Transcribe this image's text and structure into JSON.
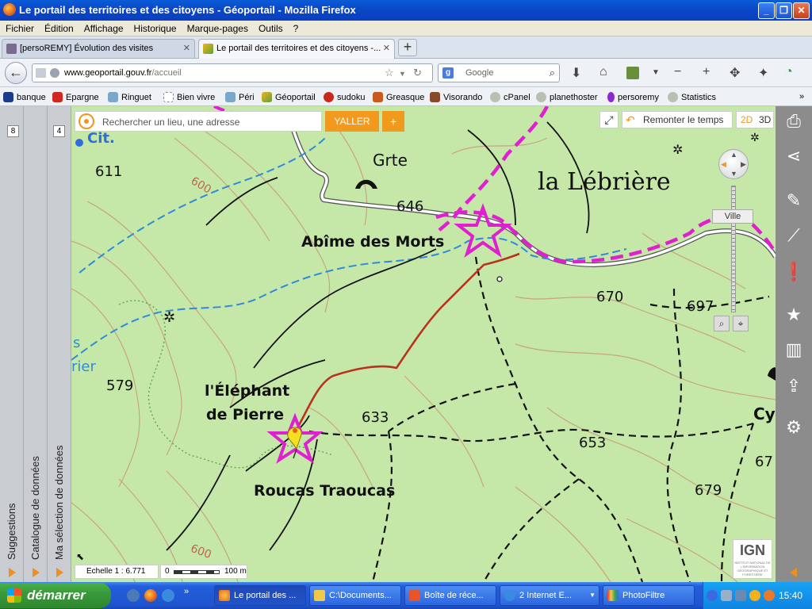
{
  "window": {
    "title": "Le portail des territoires et des citoyens - Géoportail - Mozilla Firefox"
  },
  "menu": [
    "Fichier",
    "Édition",
    "Affichage",
    "Historique",
    "Marque-pages",
    "Outils",
    "?"
  ],
  "tabs": [
    {
      "label": "[persoREMY] Évolution des visites",
      "active": false
    },
    {
      "label": "Le portail des territoires et des citoyens -...",
      "active": true
    }
  ],
  "nav": {
    "url_host": "www.geoportail.gouv.fr",
    "url_path": "/accueil",
    "search_placeholder": "Google",
    "search_engine_letter": "g"
  },
  "bookmarks": [
    "banque",
    "Epargne",
    "Ringuet",
    "Bien vivre",
    "Péri",
    "Géoportail",
    "sudoku",
    "Greasque",
    "Visorando",
    "cPanel",
    "planethoster",
    "persoremy",
    "Statistics"
  ],
  "left_panels": [
    {
      "label": "Suggestions",
      "number": "8"
    },
    {
      "label": "Catalogue de données",
      "number": ""
    },
    {
      "label": "Ma sélection de données",
      "number": "4"
    }
  ],
  "map_ui": {
    "search_placeholder": "Rechercher un lieu, une adresse",
    "go_label": "YALLER",
    "plus_label": "+",
    "remonter_label": "Remonter le temps",
    "mode_2d": "2D",
    "mode_3d": "3D",
    "zoom_level_label": "Ville",
    "scale_label": "Echelle 1 : 6.771",
    "scale_zero": "0",
    "scale_distance": "100 m",
    "ign_logo": "IGN",
    "ign_sub": "INSTITUT NATIONAL DE L'INFORMATION GÉOGRAPHIQUE ET FORESTIÈRE"
  },
  "map_labels": {
    "place_lebriere": "la Lébrière",
    "place_abime": "Abîme des Morts",
    "place_elephant_1": "l'Éléphant",
    "place_elephant_2": "de Pierre",
    "place_roucas": "Roucas Traoucas",
    "grte": "Grte",
    "cit": "Cit.",
    "cy": "Cy",
    "rier": "rier",
    "s": "s",
    "alt_611": "611",
    "alt_646": "646",
    "alt_670": "670",
    "alt_697": "697",
    "alt_579": "579",
    "alt_633": "633",
    "alt_653": "653",
    "alt_679": "679",
    "alt_67": "67",
    "contour_600a": "600",
    "contour_600b": "600"
  },
  "right_tools": [
    "printer-icon",
    "share-icon",
    "pencil-icon",
    "ruler-icon",
    "alert-icon",
    "star-icon",
    "map-icon",
    "export-icon",
    "gear-icon"
  ],
  "taskbar": {
    "start_label": "démarrer",
    "buttons": [
      {
        "label": "Le portail des ...",
        "active": true
      },
      {
        "label": "C:\\Documents...",
        "active": false
      },
      {
        "label": "Boîte de réce...",
        "active": false
      },
      {
        "label": "2 Internet E...",
        "active": false
      },
      {
        "label": "PhotoFiltre",
        "active": false
      }
    ],
    "clock": "15:40"
  },
  "colors": {
    "accent_orange": "#f29a1e",
    "trail_magenta": "#e020d0",
    "path_red": "#c8321e",
    "map_bg": "#c5e8a8"
  }
}
